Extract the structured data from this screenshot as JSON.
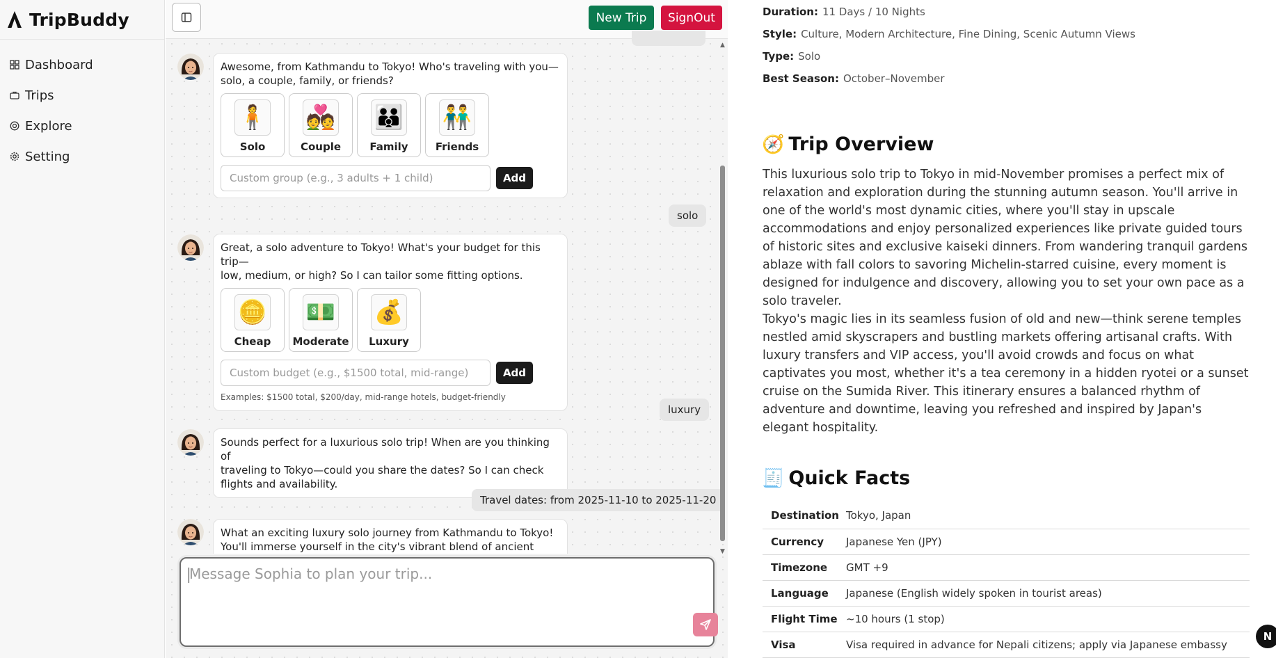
{
  "app": {
    "name": "TripBuddy"
  },
  "sidebar": {
    "items": [
      {
        "label": "Dashboard",
        "icon": "dashboard-icon"
      },
      {
        "label": "Trips",
        "icon": "briefcase-icon"
      },
      {
        "label": "Explore",
        "icon": "compass-icon"
      },
      {
        "label": "Setting",
        "icon": "gear-icon"
      }
    ]
  },
  "header": {
    "new_trip": "New Trip",
    "sign_out": "SignOut"
  },
  "chat": {
    "messages": [
      {
        "text": "Awesome, from Kathmandu to Tokyo! Who's traveling with you—\nsolo, a couple, family, or friends?",
        "options": [
          {
            "label": "Solo",
            "emoji": "🧍"
          },
          {
            "label": "Couple",
            "emoji": "💑"
          },
          {
            "label": "Family",
            "emoji": "👪"
          },
          {
            "label": "Friends",
            "emoji": "👬"
          }
        ],
        "placeholder": "Custom group (e.g., 3 adults + 1 child)",
        "add": "Add"
      },
      {
        "user": "solo"
      },
      {
        "text": "Great, a solo adventure to Tokyo! What's your budget for this trip—\nlow, medium, or high? So I can tailor some fitting options.",
        "options": [
          {
            "label": "Cheap",
            "emoji": "🪙"
          },
          {
            "label": "Moderate",
            "emoji": "💵"
          },
          {
            "label": "Luxury",
            "emoji": "💰"
          }
        ],
        "placeholder": "Custom budget (e.g., $1500 total, mid-range)",
        "add": "Add",
        "examples": "Examples: $1500 total, $200/day, mid-range hotels, budget-friendly"
      },
      {
        "user": "luxury"
      },
      {
        "text": "Sounds perfect for a luxurious solo trip! When are you thinking of\ntraveling to Tokyo—could you share the dates? So I can check\nflights and availability."
      },
      {
        "user": "Travel dates: from 2025-11-10 to 2025-11-20"
      },
      {
        "text": "What an exciting luxury solo journey from Kathmandu to Tokyo!\nYou'll immerse yourself in the city's vibrant blend of ancient"
      }
    ],
    "composer_placeholder": "Message Sophia to plan your trip..."
  },
  "trip": {
    "meta": [
      {
        "k": "Duration:",
        "v": "11 Days / 10 Nights"
      },
      {
        "k": "Style:",
        "v": "Culture, Modern Architecture, Fine Dining, Scenic Autumn Views"
      },
      {
        "k": "Type:",
        "v": "Solo"
      },
      {
        "k": "Best Season:",
        "v": "October–November"
      }
    ],
    "overview_title": "Trip Overview",
    "overview_emoji": "🧭",
    "overview_p1": "This luxurious solo trip to Tokyo in mid-November promises a perfect mix of relaxation and exploration during the stunning autumn season. You'll arrive in one of the world's most dynamic cities, where you'll stay in upscale accommodations and enjoy personalized experiences like private guided tours of historic sites and exclusive kaiseki dinners. From wandering tranquil gardens ablaze with fall colors to savoring Michelin-starred cuisine, every moment is designed for indulgence and discovery, allowing you to set your own pace as a solo traveler.",
    "overview_p2": "Tokyo's magic lies in its seamless fusion of old and new—think serene temples nestled amid skyscrapers and bustling markets offering artisanal crafts. With luxury transfers and VIP access, you'll avoid crowds and focus on what captivates you most, whether it's a tea ceremony in a hidden ryotei or a sunset cruise on the Sumida River. This itinerary ensures a balanced rhythm of adventure and downtime, leaving you refreshed and inspired by Japan's elegant hospitality.",
    "facts_title": "Quick Facts",
    "facts_emoji": "🧾",
    "facts": [
      {
        "k": "Destination",
        "v": "Tokyo, Japan"
      },
      {
        "k": "Currency",
        "v": "Japanese Yen (JPY)"
      },
      {
        "k": "Timezone",
        "v": "GMT +9"
      },
      {
        "k": "Language",
        "v": "Japanese (English widely spoken in tourist areas)"
      },
      {
        "k": "Flight Time",
        "v": "~10 hours (1 stop)"
      },
      {
        "k": "Visa",
        "v": "Visa required in advance for Nepali citizens; apply via Japanese embassy"
      }
    ]
  },
  "badge": "N",
  "colors": {
    "new_trip": "#0b7a4f",
    "sign_out": "#d4143f",
    "send": "#e7839a"
  }
}
